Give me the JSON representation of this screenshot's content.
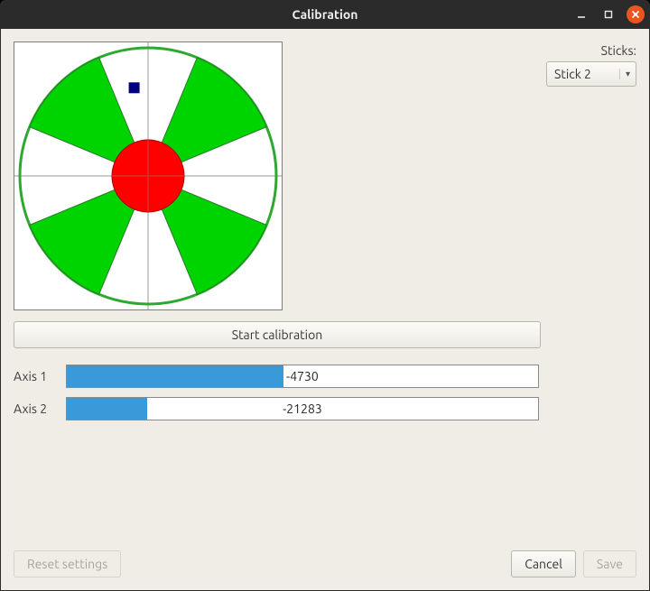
{
  "window": {
    "title": "Calibration"
  },
  "sticks": {
    "label": "Sticks:",
    "selected": "Stick 2"
  },
  "calibration_button": "Start calibration",
  "axes": [
    {
      "label": "Axis 1",
      "value": -4730,
      "fill_percent": 46.0
    },
    {
      "label": "Axis 2",
      "value": -21283,
      "fill_percent": 17.0
    }
  ],
  "buttons": {
    "reset": "Reset settings",
    "cancel": "Cancel",
    "save": "Save"
  },
  "stick_state": {
    "pointer_x_percent": 44.8,
    "pointer_y_percent": 17.0
  },
  "colors": {
    "wedge": "#00d400",
    "deadzone": "#ff0000",
    "ring": "#2fa82f",
    "pointer": "#000080",
    "bar_fill": "#3a99d8",
    "window_bg": "#f0ede6",
    "titlebar": "#2b2b2b",
    "close_btn": "#e95420"
  }
}
